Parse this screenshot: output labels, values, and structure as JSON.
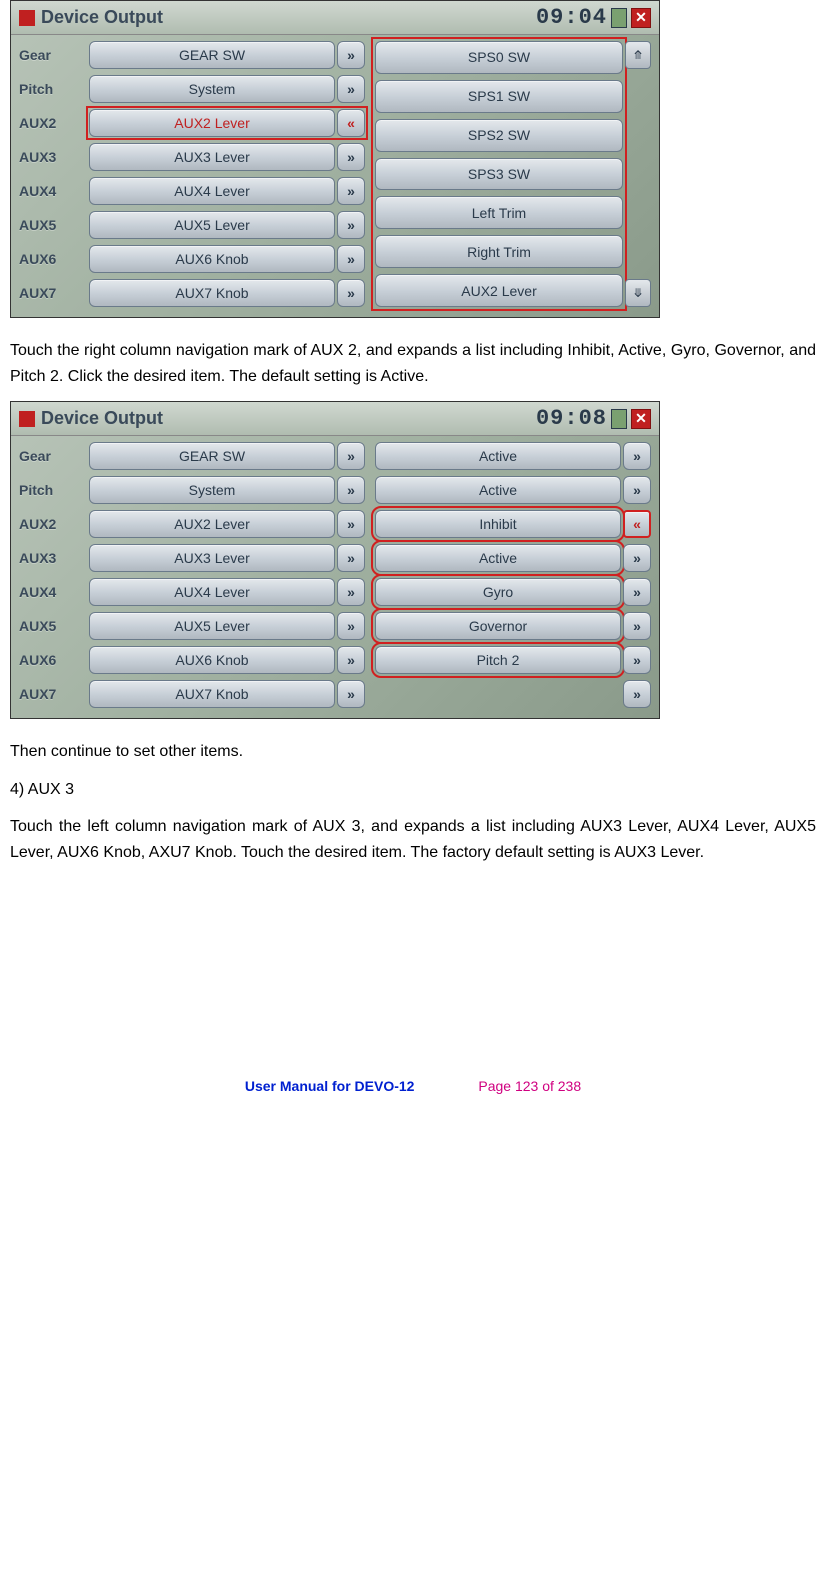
{
  "screenshot1": {
    "title": "Device Output",
    "clock": "09:04",
    "labels": [
      "Gear",
      "Pitch",
      "AUX2",
      "AUX3",
      "AUX4",
      "AUX5",
      "AUX6",
      "AUX7"
    ],
    "left_buttons": [
      "GEAR SW",
      "System",
      "AUX2 Lever",
      "AUX3 Lever",
      "AUX4 Lever",
      "AUX5 Lever",
      "AUX6 Knob",
      "AUX7 Knob"
    ],
    "left_nav": [
      "»",
      "»",
      "«",
      "»",
      "»",
      "»",
      "»",
      "»"
    ],
    "right_buttons": [
      "SPS0 SW",
      "SPS1 SW",
      "SPS2 SW",
      "SPS3 SW",
      "Left Trim",
      "Right Trim",
      "AUX2 Lever"
    ],
    "up_glyph": "⤊",
    "down_glyph": "⤋"
  },
  "para1": "Touch the right column navigation mark of AUX 2, and expands a list including Inhibit, Active, Gyro, Governor, and Pitch 2. Click the desired item. The default setting is Active.",
  "screenshot2": {
    "title": "Device Output",
    "clock": "09:08",
    "labels": [
      "Gear",
      "Pitch",
      "AUX2",
      "AUX3",
      "AUX4",
      "AUX5",
      "AUX6",
      "AUX7"
    ],
    "left_buttons": [
      "GEAR SW",
      "System",
      "AUX2 Lever",
      "AUX3 Lever",
      "AUX4 Lever",
      "AUX5 Lever",
      "AUX6 Knob",
      "AUX7 Knob"
    ],
    "left_nav": [
      "»",
      "»",
      "»",
      "»",
      "»",
      "»",
      "»",
      "»"
    ],
    "right_top": [
      "Active",
      "Active"
    ],
    "right_top_nav": [
      "»",
      "»"
    ],
    "dropdown": [
      "Inhibit",
      "Active",
      "Gyro",
      "Governor",
      "Pitch 2"
    ],
    "right_rest_nav": [
      "«",
      "»",
      "»",
      "»",
      "»",
      "»"
    ]
  },
  "para2": "Then continue to set other items.",
  "heading4": "4)    AUX 3",
  "para3": "Touch the left column navigation mark of AUX 3, and expands a list including AUX3 Lever, AUX4 Lever, AUX5 Lever, AUX6 Knob, AXU7 Knob. Touch the desired item. The factory default setting is AUX3 Lever.",
  "footer": {
    "manual": "User Manual for DEVO-12",
    "page": "Page 123 of 238"
  }
}
